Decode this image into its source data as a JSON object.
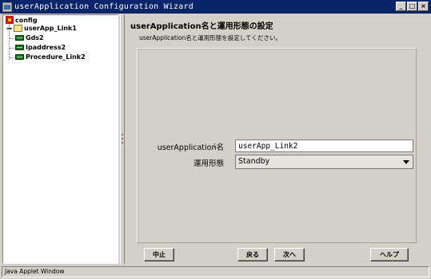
{
  "window": {
    "title": "userApplication Configuration Wizard",
    "minimize_icon": "minimize-icon",
    "maximize_icon": "maximize-icon",
    "close_icon": "close-icon",
    "minimize_glyph": "_",
    "maximize_glyph": "□",
    "close_glyph": "×"
  },
  "tree": {
    "root": {
      "label": "config",
      "icon": "config-icon"
    },
    "app": {
      "label": "userApp_Link1",
      "icon": "folder-icon"
    },
    "children": [
      {
        "label": "Gds2",
        "icon": "resource-icon"
      },
      {
        "label": "Ipaddress2",
        "icon": "resource-icon"
      },
      {
        "label": "Procedure_Link2",
        "icon": "resource-icon"
      }
    ]
  },
  "main": {
    "title": "userApplication名と運用形態の設定",
    "description": "userApplication名と運用形態を設定してください。",
    "name_label": "userApplication名",
    "name_sep": ":",
    "name_value": "userApp_Link2",
    "mode_label": "運用形態",
    "mode_sep": ":",
    "mode_value": "Standby"
  },
  "buttons": {
    "cancel": "中止",
    "back": "戻る",
    "next": "次へ",
    "help": "ヘルプ"
  },
  "status": {
    "text": "Java Applet Window"
  }
}
